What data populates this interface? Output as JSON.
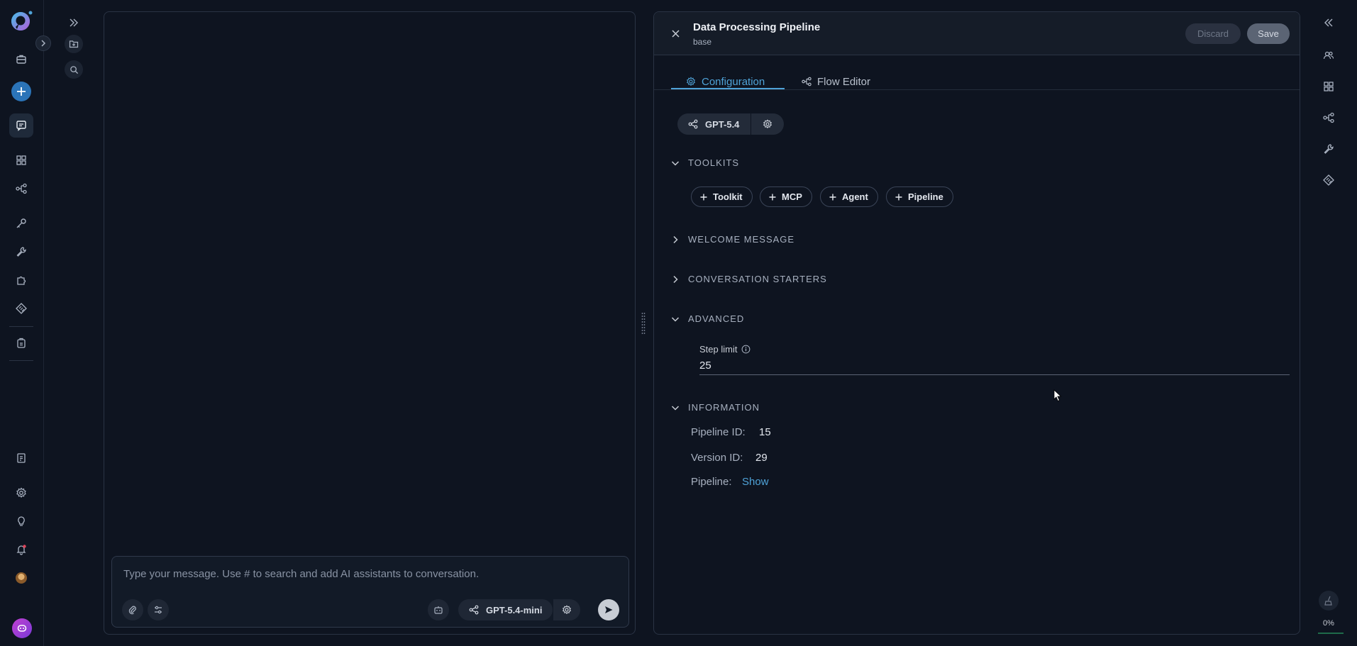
{
  "chat": {
    "placeholder": "Type your message. Use # to search and add AI assistants to conversation.",
    "model_label": "GPT-5.4-mini"
  },
  "panel": {
    "title": "Data Processing Pipeline",
    "subtitle": "base",
    "discard_label": "Discard",
    "save_label": "Save",
    "tabs": [
      {
        "label": "Configuration",
        "active": true
      },
      {
        "label": "Flow Editor",
        "active": false
      }
    ],
    "model_label": "GPT-5.4",
    "sections": {
      "toolkits": "TOOLKITS",
      "welcome": "WELCOME MESSAGE",
      "starters": "CONVERSATION STARTERS",
      "advanced": "ADVANCED",
      "information": "INFORMATION"
    },
    "toolkit_buttons": [
      "Toolkit",
      "MCP",
      "Agent",
      "Pipeline"
    ],
    "step_limit_label": "Step limit",
    "step_limit_value": "25",
    "info": {
      "pipeline_id_label": "Pipeline ID:",
      "pipeline_id": "15",
      "version_id_label": "Version ID:",
      "version_id": "29",
      "pipeline_label": "Pipeline:",
      "pipeline_link": "Show"
    }
  },
  "progress_label": "0%",
  "colors": {
    "accent": "#4fa3d8",
    "background": "#0e1420",
    "panel_header": "#151c28",
    "save_button": "#5b6474",
    "notification": "#e0445a"
  }
}
